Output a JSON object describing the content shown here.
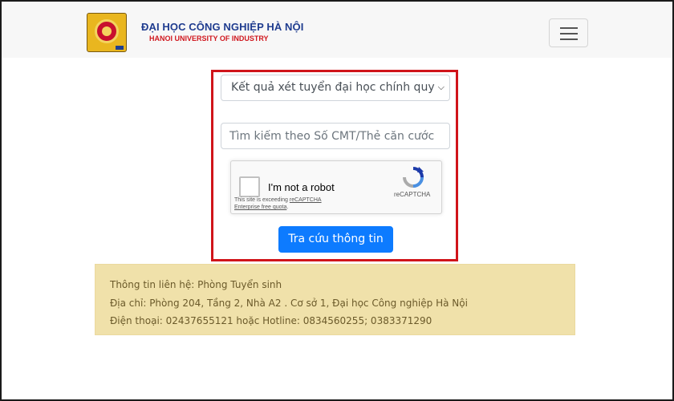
{
  "header": {
    "logo_icon": "university-seal-icon",
    "name_vn": "ĐẠI HỌC CÔNG NGHIỆP HÀ NỘI",
    "name_en": "HANOI UNIVERSITY OF INDUSTRY",
    "menu_icon": "hamburger-menu-icon",
    "colors": {
      "navy": "#1f3c8f",
      "red": "#d0181f",
      "navbar_bg": "#f7f7f7"
    }
  },
  "form": {
    "select_value": "Kết quả xét tuyển đại học chính quy",
    "search_placeholder": "Tìm kiếm theo Số CMT/Thẻ căn cước",
    "captcha": {
      "label": "I'm not a robot",
      "note_prefix": "This site is exceeding ",
      "note_link1": "reCAPTCHA",
      "note_link2": "Enterprise free quota",
      "note_suffix": ".",
      "brand": "reCAPTCHA"
    },
    "submit_label": "Tra cứu thông tin",
    "highlight_color": "#d0141a",
    "button_color": "#0d7bff"
  },
  "contact": {
    "line1": "Thông tin liên hệ: Phòng Tuyển sinh",
    "line2": "Địa chỉ: Phòng 204, Tầng 2, Nhà A2 . Cơ sở 1, Đại học Công nghiệp Hà Nội",
    "line3": "Điện thoại: 02437655121 hoặc Hotline: 0834560255; 0383371290",
    "bg_color": "#f0e1aa"
  }
}
